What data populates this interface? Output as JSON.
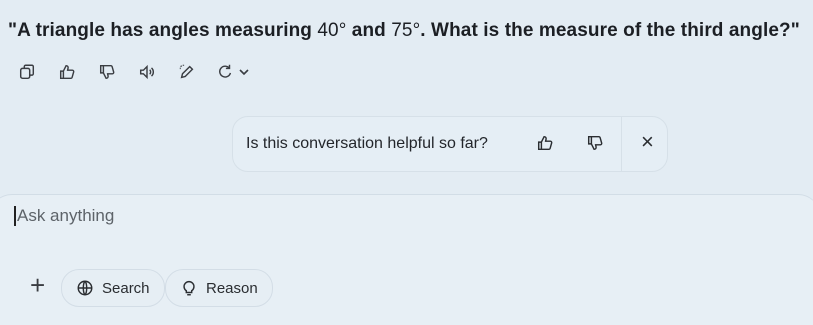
{
  "question": {
    "part1": "\"A triangle has angles measuring ",
    "angle1": "40°",
    "part2": " and ",
    "angle2": "75°",
    "part3": ". What is the measure of the third angle?\""
  },
  "actions": {
    "icons": [
      "copy-icon",
      "thumbs-up-icon",
      "thumbs-down-icon",
      "read-aloud-icon",
      "edit-icon",
      "regenerate-icon"
    ]
  },
  "feedback": {
    "prompt": "Is this conversation helpful so far?",
    "close": "×"
  },
  "composer": {
    "placeholder": "Ask anything",
    "plus": "+",
    "search_label": "Search",
    "reason_label": "Reason"
  }
}
